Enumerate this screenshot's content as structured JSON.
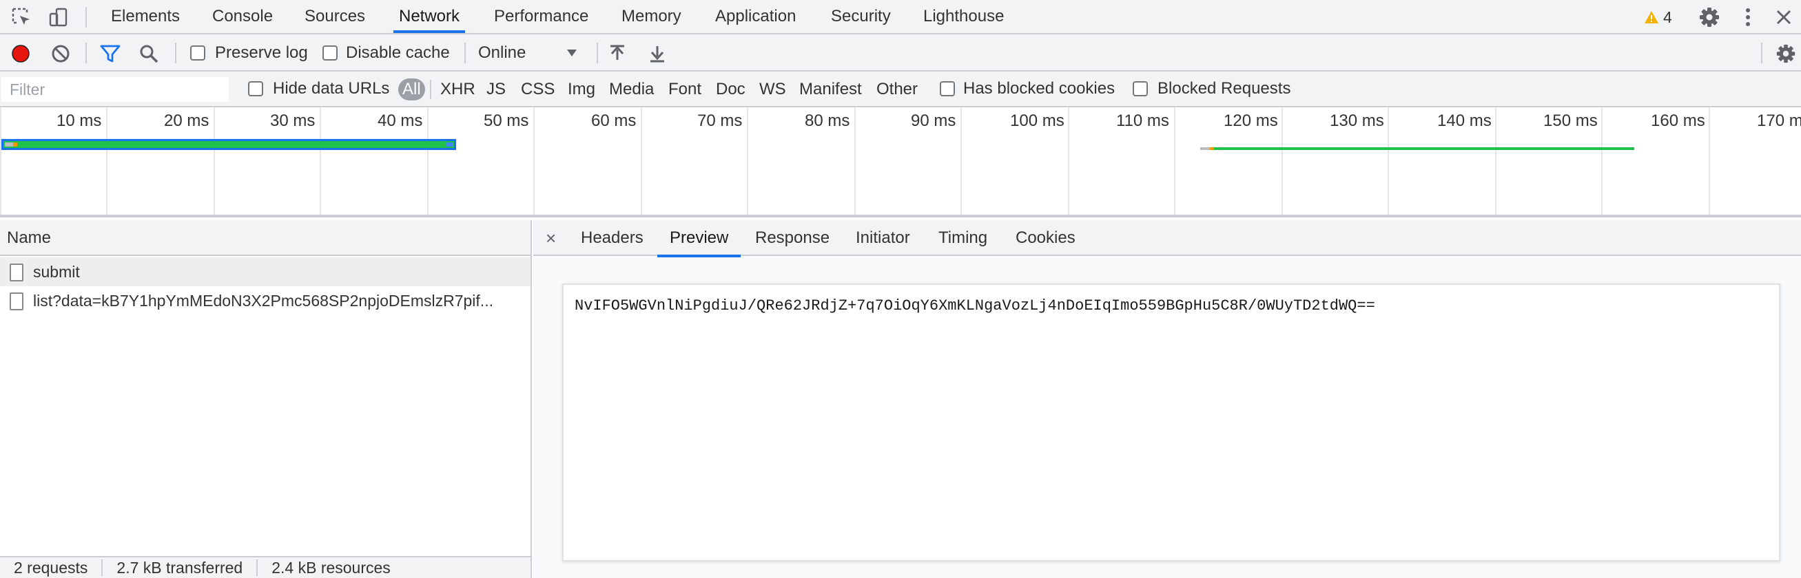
{
  "tabs": [
    "Elements",
    "Console",
    "Sources",
    "Network",
    "Performance",
    "Memory",
    "Application",
    "Security",
    "Lighthouse"
  ],
  "active_tab": "Network",
  "warning_count": "4",
  "toolbar": {
    "preserve_log": "Preserve log",
    "disable_cache": "Disable cache",
    "throttling": "Online"
  },
  "filter": {
    "placeholder": "Filter",
    "hide_data_urls": "Hide data URLs",
    "types": [
      "All",
      "XHR",
      "JS",
      "CSS",
      "Img",
      "Media",
      "Font",
      "Doc",
      "WS",
      "Manifest",
      "Other"
    ],
    "has_blocked_cookies": "Has blocked cookies",
    "blocked_requests": "Blocked Requests"
  },
  "timeline": {
    "ticks": [
      "10 ms",
      "20 ms",
      "30 ms",
      "40 ms",
      "50 ms",
      "60 ms",
      "70 ms",
      "80 ms",
      "90 ms",
      "100 ms",
      "110 ms",
      "120 ms",
      "130 ms",
      "140 ms",
      "150 ms",
      "160 ms",
      "170 m"
    ]
  },
  "requests_panel": {
    "column_name": "Name",
    "rows": [
      "submit",
      "list?data=kB7Y1hpYmMEdoN3X2Pmc568SP2npjoDEmslzR7pif..."
    ]
  },
  "status": {
    "requests": "2 requests",
    "transferred": "2.7 kB transferred",
    "resources": "2.4 kB resources"
  },
  "detail": {
    "close": "×",
    "tabs": [
      "Headers",
      "Preview",
      "Response",
      "Initiator",
      "Timing",
      "Cookies"
    ],
    "active_tab": "Preview",
    "preview_text": "NvIFO5WGVnlNiPgdiuJ/QRe62JRdjZ+7q7OiOqY6XmKLNgaVozLj4nDoEIqImo559BGpHu5C8R/0WUyTD2tdWQ=="
  },
  "colors": {
    "accent": "#1a73e8",
    "record": "#e8150e",
    "warning": "#f2b300",
    "waterfall_green": "#1ec14b",
    "waterfall_blue": "#1a73e8"
  }
}
